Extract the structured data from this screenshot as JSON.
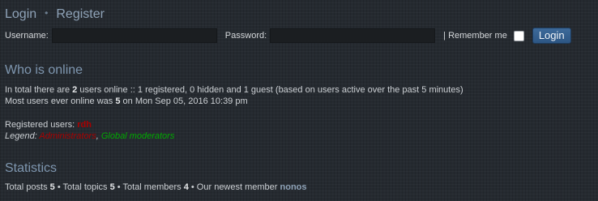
{
  "header": {
    "login_link": "Login",
    "separator": "•",
    "register_link": "Register"
  },
  "login_form": {
    "username_label": "Username:",
    "username_value": "",
    "password_label": "Password:",
    "password_value": "",
    "remember_label": "| Remember me",
    "remember_checked": false,
    "login_button": "Login"
  },
  "who_is_online": {
    "title": "Who is online",
    "total_prefix": "In total there are ",
    "total_count": "2",
    "total_suffix": " users online :: 1 registered, 0 hidden and 1 guest (based on users active over the past 5 minutes)",
    "most_prefix": "Most users ever online was ",
    "most_count": "5",
    "most_suffix": " on Mon Sep 05, 2016 10:39 pm",
    "registered_label": "Registered users: ",
    "registered_user": "rdh",
    "legend_label": "Legend: ",
    "legend_admin": "Administrators",
    "legend_separator": ", ",
    "legend_global": "Global moderators"
  },
  "statistics": {
    "title": "Statistics",
    "posts_label": "Total posts ",
    "posts_count": "5",
    "topics_label": " • Total topics ",
    "topics_count": "5",
    "members_label": " • Total members ",
    "members_count": "4",
    "newest_label": " • Our newest member ",
    "newest_member": "nonos"
  },
  "colors": {
    "background": "#252a30",
    "heading": "#7f97b0",
    "admin": "#aa0000",
    "global_moderator": "#00aa00",
    "button": "#2d5684"
  }
}
